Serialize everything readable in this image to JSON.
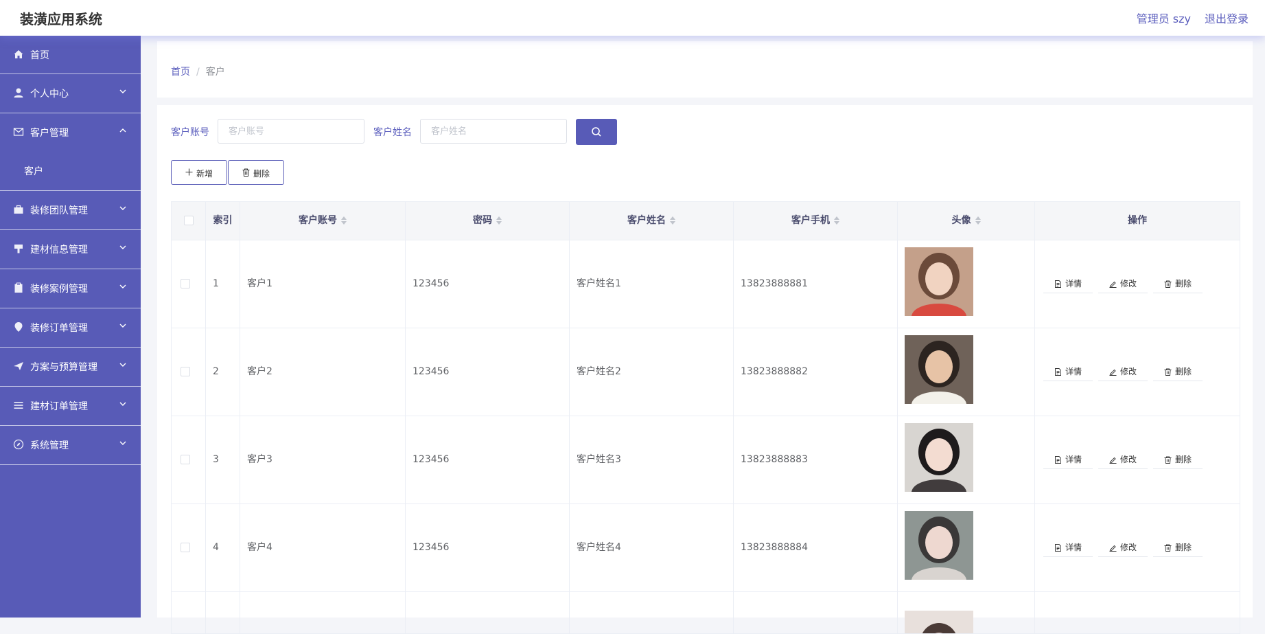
{
  "header": {
    "title": "装潢应用系统",
    "admin": "管理员 szy",
    "logout": "退出登录"
  },
  "sidebar": {
    "items": [
      {
        "label": "首页",
        "icon": "home-icon"
      },
      {
        "label": "个人中心",
        "icon": "user-icon"
      },
      {
        "label": "客户管理",
        "icon": "message-icon",
        "expanded": true,
        "children": [
          {
            "label": "客户"
          }
        ]
      },
      {
        "label": "装修团队管理",
        "icon": "briefcase-icon"
      },
      {
        "label": "建材信息管理",
        "icon": "brush-icon"
      },
      {
        "label": "装修案例管理",
        "icon": "clipboard-icon"
      },
      {
        "label": "装修订单管理",
        "icon": "location-icon"
      },
      {
        "label": "方案与预算管理",
        "icon": "send-icon"
      },
      {
        "label": "建材订单管理",
        "icon": "menu-icon"
      },
      {
        "label": "系统管理",
        "icon": "compass-icon"
      }
    ]
  },
  "breadcrumb": {
    "home": "首页",
    "separator": "/",
    "current": "客户"
  },
  "search": {
    "account_label": "客户账号",
    "account_placeholder": "客户账号",
    "name_label": "客户姓名",
    "name_placeholder": "客户姓名"
  },
  "toolbar": {
    "add_label": "新增",
    "delete_label": "删除"
  },
  "table": {
    "columns": {
      "index": "索引",
      "account": "客户账号",
      "password": "密码",
      "name": "客户姓名",
      "phone": "客户手机",
      "avatar": "头像",
      "actions": "操作"
    },
    "action_labels": {
      "detail": "详情",
      "edit": "修改",
      "delete": "删除"
    },
    "rows": [
      {
        "index": "1",
        "account": "客户1",
        "password": "123456",
        "name": "客户姓名1",
        "phone": "13823888881"
      },
      {
        "index": "2",
        "account": "客户2",
        "password": "123456",
        "name": "客户姓名2",
        "phone": "13823888882"
      },
      {
        "index": "3",
        "account": "客户3",
        "password": "123456",
        "name": "客户姓名3",
        "phone": "13823888883"
      },
      {
        "index": "4",
        "account": "客户4",
        "password": "123456",
        "name": "客户姓名4",
        "phone": "13823888884"
      }
    ]
  },
  "colors": {
    "accent": "#585bb7",
    "link": "#5b5ebd"
  }
}
